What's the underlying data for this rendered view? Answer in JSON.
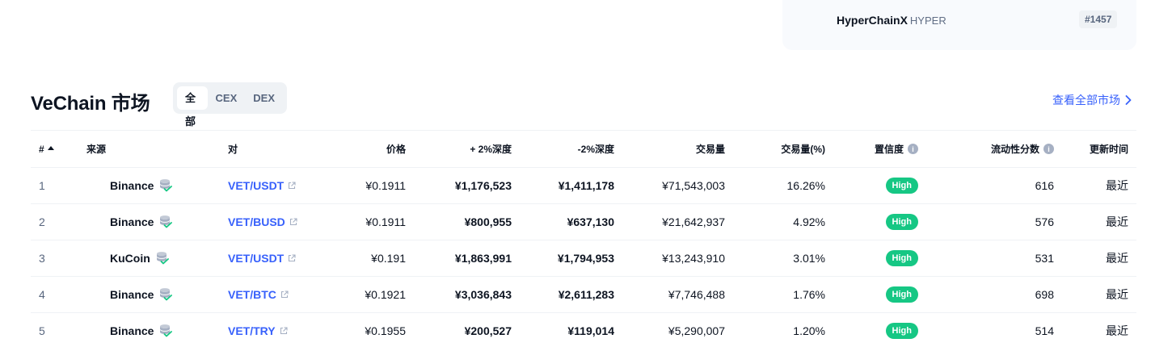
{
  "top_card": {
    "name": "HyperChainX",
    "symbol": "HYPER",
    "rank": "#1457"
  },
  "section": {
    "title": "VeChain 市场",
    "view_all": "查看全部市场"
  },
  "tabs": [
    {
      "label": "全部",
      "active": true
    },
    {
      "label": "CEX",
      "active": false
    },
    {
      "label": "DEX",
      "active": false
    }
  ],
  "table": {
    "headers": {
      "rank": "#",
      "source": "来源",
      "pair": "对",
      "price": "价格",
      "plus2": "+ 2%深度",
      "minus2": "-2%深度",
      "volume": "交易量",
      "volume_pct": "交易量(%)",
      "confidence": "置信度",
      "liquidity": "流动性分数",
      "updated": "更新时间"
    },
    "rows": [
      {
        "rank": "1",
        "exchange": "Binance",
        "pair": "VET/USDT",
        "price": "¥0.1911",
        "plus2": "¥1,176,523",
        "minus2": "¥1,411,178",
        "volume": "¥71,543,003",
        "volume_pct": "16.26%",
        "confidence": "High",
        "liquidity": "616",
        "updated": "最近"
      },
      {
        "rank": "2",
        "exchange": "Binance",
        "pair": "VET/BUSD",
        "price": "¥0.1911",
        "plus2": "¥800,955",
        "minus2": "¥637,130",
        "volume": "¥21,642,937",
        "volume_pct": "4.92%",
        "confidence": "High",
        "liquidity": "576",
        "updated": "最近"
      },
      {
        "rank": "3",
        "exchange": "KuCoin",
        "pair": "VET/USDT",
        "price": "¥0.191",
        "plus2": "¥1,863,991",
        "minus2": "¥1,794,953",
        "volume": "¥13,243,910",
        "volume_pct": "3.01%",
        "confidence": "High",
        "liquidity": "531",
        "updated": "最近"
      },
      {
        "rank": "4",
        "exchange": "Binance",
        "pair": "VET/BTC",
        "price": "¥0.1921",
        "plus2": "¥3,036,843",
        "minus2": "¥2,611,283",
        "volume": "¥7,746,488",
        "volume_pct": "1.76%",
        "confidence": "High",
        "liquidity": "698",
        "updated": "最近"
      },
      {
        "rank": "5",
        "exchange": "Binance",
        "pair": "VET/TRY",
        "price": "¥0.1955",
        "plus2": "¥200,527",
        "minus2": "¥119,014",
        "volume": "¥5,290,007",
        "volume_pct": "1.20%",
        "confidence": "High",
        "liquidity": "514",
        "updated": "最近"
      }
    ]
  },
  "colors": {
    "link": "#3861fb",
    "high_badge": "#16c784",
    "verified_check": "#16c784"
  }
}
